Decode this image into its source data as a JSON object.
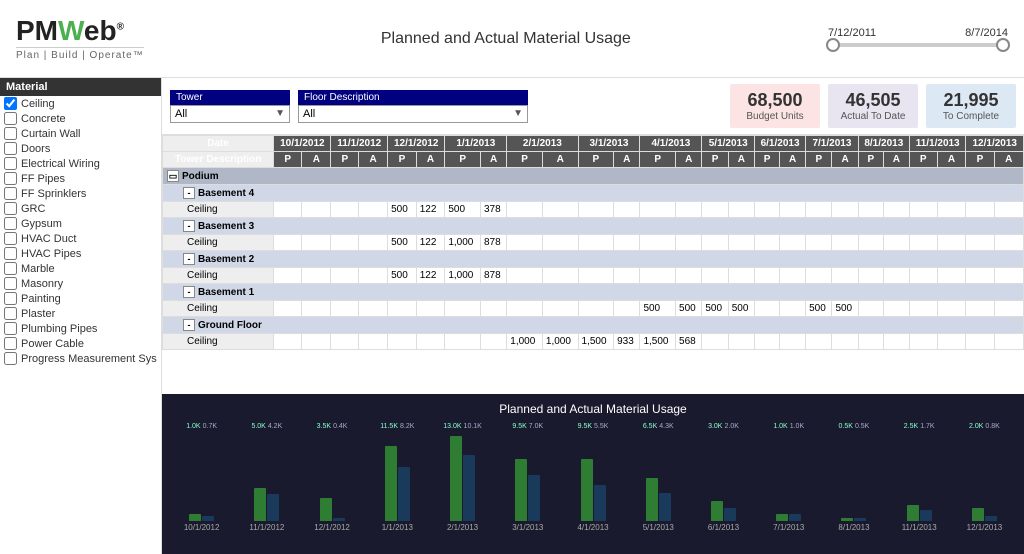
{
  "header": {
    "logo_main": "PMWeb",
    "logo_highlight": "W",
    "logo_subtitle": "Plan | Build | Operate™",
    "title": "Planned and Actual Material Usage",
    "date_start": "7/12/2011",
    "date_end": "8/7/2014"
  },
  "kpis": {
    "budget_value": "68,500",
    "budget_label": "Budget Units",
    "actual_value": "46,505",
    "actual_label": "Actual To Date",
    "complete_value": "21,995",
    "complete_label": "To Complete"
  },
  "filters": {
    "tower_label": "Tower",
    "tower_value": "All",
    "floor_label": "Floor Description",
    "floor_value": "All"
  },
  "sidebar": {
    "header": "Material",
    "items": [
      {
        "label": "Ceiling",
        "checked": true
      },
      {
        "label": "Concrete",
        "checked": false
      },
      {
        "label": "Curtain Wall",
        "checked": false
      },
      {
        "label": "Doors",
        "checked": false
      },
      {
        "label": "Electrical Wiring",
        "checked": false
      },
      {
        "label": "FF Pipes",
        "checked": false
      },
      {
        "label": "FF Sprinklers",
        "checked": false
      },
      {
        "label": "GRC",
        "checked": false
      },
      {
        "label": "Gypsum",
        "checked": false
      },
      {
        "label": "HVAC Duct",
        "checked": false
      },
      {
        "label": "HVAC Pipes",
        "checked": false
      },
      {
        "label": "Marble",
        "checked": false
      },
      {
        "label": "Masonry",
        "checked": false
      },
      {
        "label": "Painting",
        "checked": false
      },
      {
        "label": "Plaster",
        "checked": false
      },
      {
        "label": "Plumbing Pipes",
        "checked": false
      },
      {
        "label": "Power Cable",
        "checked": false
      },
      {
        "label": "Progress Measurement Sys",
        "checked": false
      }
    ]
  },
  "table": {
    "dates": [
      "10/1/2012",
      "11/1/2012",
      "12/1/2012",
      "1/1/2013",
      "2/1/2013",
      "3/1/2013",
      "4/1/2013",
      "5/1/2013",
      "6/1/2013",
      "7/1/2013",
      "8/1/2013",
      "11/1/2013",
      "12/1/2013"
    ],
    "groups": [
      {
        "name": "Podium",
        "subgroups": [
          {
            "name": "Basement 4",
            "rows": [
              {
                "desc": "Ceiling",
                "values": {
                  "12/1/2012_P": "500",
                  "12/1/2012_A": "122",
                  "1/1/2013_P": "500",
                  "1/1/2013_A": "378"
                }
              }
            ]
          },
          {
            "name": "Basement 3",
            "rows": [
              {
                "desc": "Ceiling",
                "values": {
                  "12/1/2012_P": "500",
                  "12/1/2012_A": "122",
                  "1/1/2013_P": "1,000",
                  "1/1/2013_A": "878"
                }
              }
            ]
          },
          {
            "name": "Basement 2",
            "rows": [
              {
                "desc": "Ceiling",
                "values": {
                  "12/1/2012_P": "500",
                  "12/1/2012_A": "122",
                  "1/1/2013_P": "1,000",
                  "1/1/2013_A": "878"
                }
              }
            ]
          },
          {
            "name": "Basement 1",
            "rows": [
              {
                "desc": "Ceiling",
                "values": {
                  "4/1/2013_P": "500",
                  "4/1/2013_A": "500",
                  "5/1/2013_P": "500",
                  "5/1/2013_A": "500",
                  "7/1/2013_P": "500",
                  "7/1/2013_A": "500"
                }
              }
            ]
          },
          {
            "name": "Ground Floor",
            "rows": [
              {
                "desc": "Ceiling",
                "values": {
                  "2/1/2013_P": "1,000",
                  "2/1/2013_A": "1,000",
                  "3/1/2013_P": "1,500",
                  "3/1/2013_A": "933",
                  "4/1/2013_P": "1,500",
                  "4/1/2013_A": "568"
                }
              }
            ]
          }
        ]
      }
    ]
  },
  "chart": {
    "title": "Planned and Actual Material Usage",
    "bars": [
      {
        "date": "10/1/2012",
        "planned": 1.0,
        "actual": 0.7,
        "planned_label": "1.0K",
        "actual_label": "0.7K"
      },
      {
        "date": "11/1/2012",
        "planned": 5.0,
        "actual": 4.2,
        "planned_label": "5.0K",
        "actual_label": "4.2K"
      },
      {
        "date": "12/1/2012",
        "planned": 3.5,
        "actual": 0.4,
        "planned_label": "3.5K",
        "actual_label": "0.4K"
      },
      {
        "date": "1/1/2013",
        "planned": 11.5,
        "actual": 8.2,
        "planned_label": "11.5K",
        "actual_label": "8.2K"
      },
      {
        "date": "2/1/2013",
        "planned": 13.0,
        "actual": 10.1,
        "planned_label": "13.0K",
        "actual_label": "10.1K"
      },
      {
        "date": "3/1/2013",
        "planned": 9.5,
        "actual": 7.0,
        "planned_label": "9.5K",
        "actual_label": "7.0K"
      },
      {
        "date": "4/1/2013",
        "planned": 9.5,
        "actual": 5.5,
        "planned_label": "9.5K",
        "actual_label": "5.5K"
      },
      {
        "date": "5/1/2013",
        "planned": 6.5,
        "actual": 4.3,
        "planned_label": "6.5K",
        "actual_label": "4.3K"
      },
      {
        "date": "6/1/2013",
        "planned": 3.0,
        "actual": 2.0,
        "planned_label": "3.0K",
        "actual_label": "2.0K"
      },
      {
        "date": "7/1/2013",
        "planned": 1.0,
        "actual": 1.0,
        "planned_label": "1.0K",
        "actual_label": "1.0K"
      },
      {
        "date": "8/1/2013",
        "planned": 0.5,
        "actual": 0.5,
        "planned_label": "0.5K",
        "actual_label": "0.5K"
      },
      {
        "date": "11/1/2013",
        "planned": 2.5,
        "actual": 1.7,
        "planned_label": "2.5K",
        "actual_label": "1.7K"
      },
      {
        "date": "12/1/2013",
        "planned": 2.0,
        "actual": 0.8,
        "planned_label": "2.0K",
        "actual_label": "0.8K"
      }
    ],
    "max_value": 13.0
  }
}
